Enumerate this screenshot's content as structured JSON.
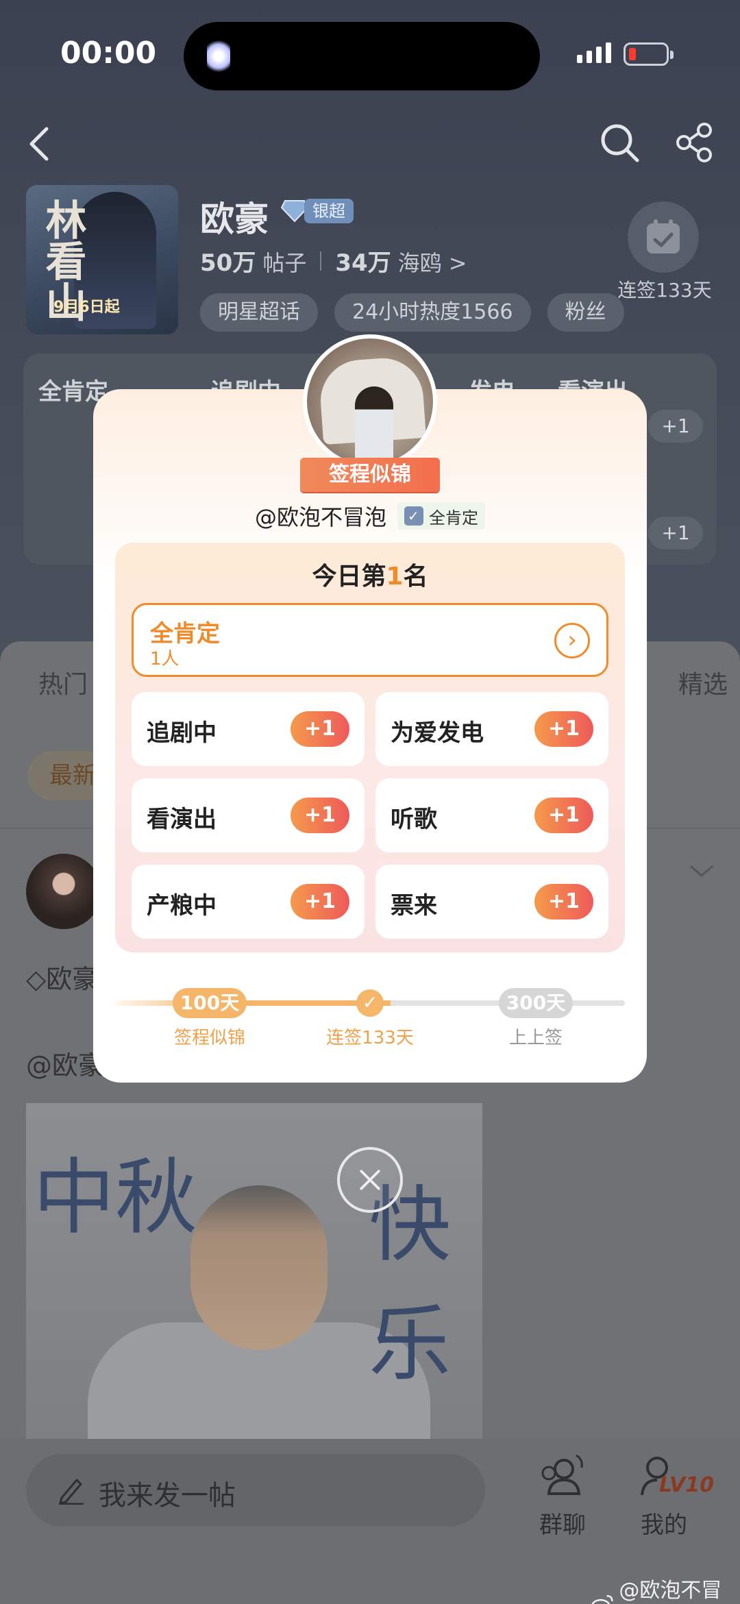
{
  "status_bar": {
    "time": "00:00"
  },
  "topic": {
    "name": "欧豪",
    "badge": "银超",
    "posts_count": "50万",
    "posts_label": "帖子",
    "followers_count": "34万",
    "followers_label": "海鸥",
    "followers_arrow": ">",
    "chips": [
      "明星超话",
      "24小时热度1566",
      "粉丝"
    ],
    "poster_title": "林看山",
    "poster_date": "9月6日起",
    "checkin_label": "连签133天"
  },
  "bg_grid": {
    "cells": [
      "全肯定",
      "追剧中",
      "发电",
      "看演出"
    ],
    "plus_label": "+1"
  },
  "bg_tabs": {
    "hot": "热门",
    "pick": "精选",
    "newest": "最新"
  },
  "bg_post": {
    "diamond_text": "欧豪",
    "mention_text": "@欧豪",
    "calligraphy_1": "中秋",
    "calligraphy_2": "快乐"
  },
  "bottom_bar": {
    "compose_placeholder": "我来发一帖",
    "group_chat_label": "群聊",
    "mine_label": "我的",
    "level_badge": "LV10"
  },
  "watermark": "@欧泡不冒泡",
  "modal": {
    "ribbon": "签程似锦",
    "username": "@欧泡不冒泡",
    "verify_label": "全肯定",
    "rank_prefix": "今日第",
    "rank_number": "1",
    "rank_suffix": "名",
    "featured": {
      "name": "全肯定",
      "count": "1人",
      "arrow": "›"
    },
    "options": [
      {
        "name": "追剧中",
        "plus": "+1"
      },
      {
        "name": "为爱发电",
        "plus": "+1"
      },
      {
        "name": "看演出",
        "plus": "+1"
      },
      {
        "name": "听歌",
        "plus": "+1"
      },
      {
        "name": "产粮中",
        "plus": "+1"
      },
      {
        "name": "票来",
        "plus": "+1"
      }
    ],
    "progress": {
      "milestone_1": "100天",
      "milestone_3": "300天",
      "label_1": "签程似锦",
      "label_2": "连签133天",
      "label_3": "上上签",
      "check": "✓",
      "current_days": 133
    },
    "close_symbol": "✕"
  },
  "colors": {
    "accent": "#f08a2a",
    "plus_gradient_start": "#f59a4c",
    "plus_gradient_end": "#ee5a5a"
  }
}
